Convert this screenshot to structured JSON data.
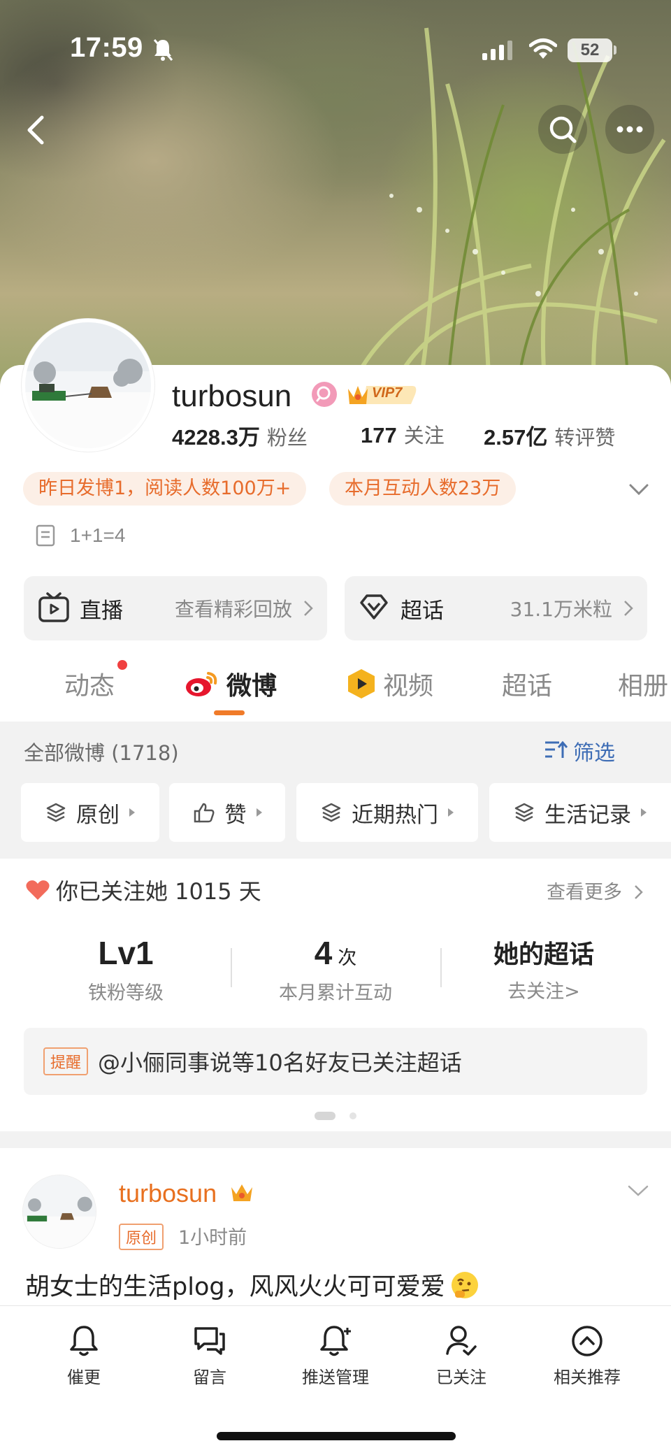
{
  "status_bar": {
    "time": "17:59",
    "battery": "52"
  },
  "profile": {
    "username": "turbosun",
    "vip_level": "VIP7",
    "stats": [
      {
        "value": "4228.3万",
        "label": "粉丝"
      },
      {
        "value": "177",
        "label": "关注"
      },
      {
        "value": "2.57亿",
        "label": "转评赞"
      }
    ],
    "highlights": [
      "昨日发博1，阅读人数100万+",
      "本月互动人数23万"
    ],
    "bio": "1+1=4"
  },
  "features": [
    {
      "title": "直播",
      "sub": "查看精彩回放"
    },
    {
      "title": "超话",
      "sub": "31.1万米粒"
    }
  ],
  "tabs": [
    "动态",
    "微博",
    "视频",
    "超话",
    "相册"
  ],
  "feed_filter": {
    "all_label": "全部微博 (1718)",
    "filter_label": "筛选",
    "chips": [
      "原创",
      "赞",
      "近期热门",
      "生活记录"
    ]
  },
  "fan_card": {
    "follow_text": "你已关注她 1015 天",
    "see_more": "查看更多",
    "stats": [
      {
        "value": "Lv1",
        "unit": "",
        "label": "铁粉等级"
      },
      {
        "value": "4",
        "unit": "次",
        "label": "本月累计互动"
      },
      {
        "value": "她的超话",
        "unit": "",
        "label": "去关注>"
      }
    ],
    "remind_tag": "提醒",
    "remind_text": "@小俪同事说等10名好友已关注超话"
  },
  "post": {
    "author": "turbosun",
    "tag": "原创",
    "time": "1小时前",
    "text": "胡女士的生活plog，风风火火可可爱爱"
  },
  "bottom_bar": [
    "催更",
    "留言",
    "推送管理",
    "已关注",
    "相关推荐"
  ],
  "colors": {
    "accent": "#f07b29",
    "link": "#3e6db5",
    "badge_bg": "#fcefe6"
  }
}
